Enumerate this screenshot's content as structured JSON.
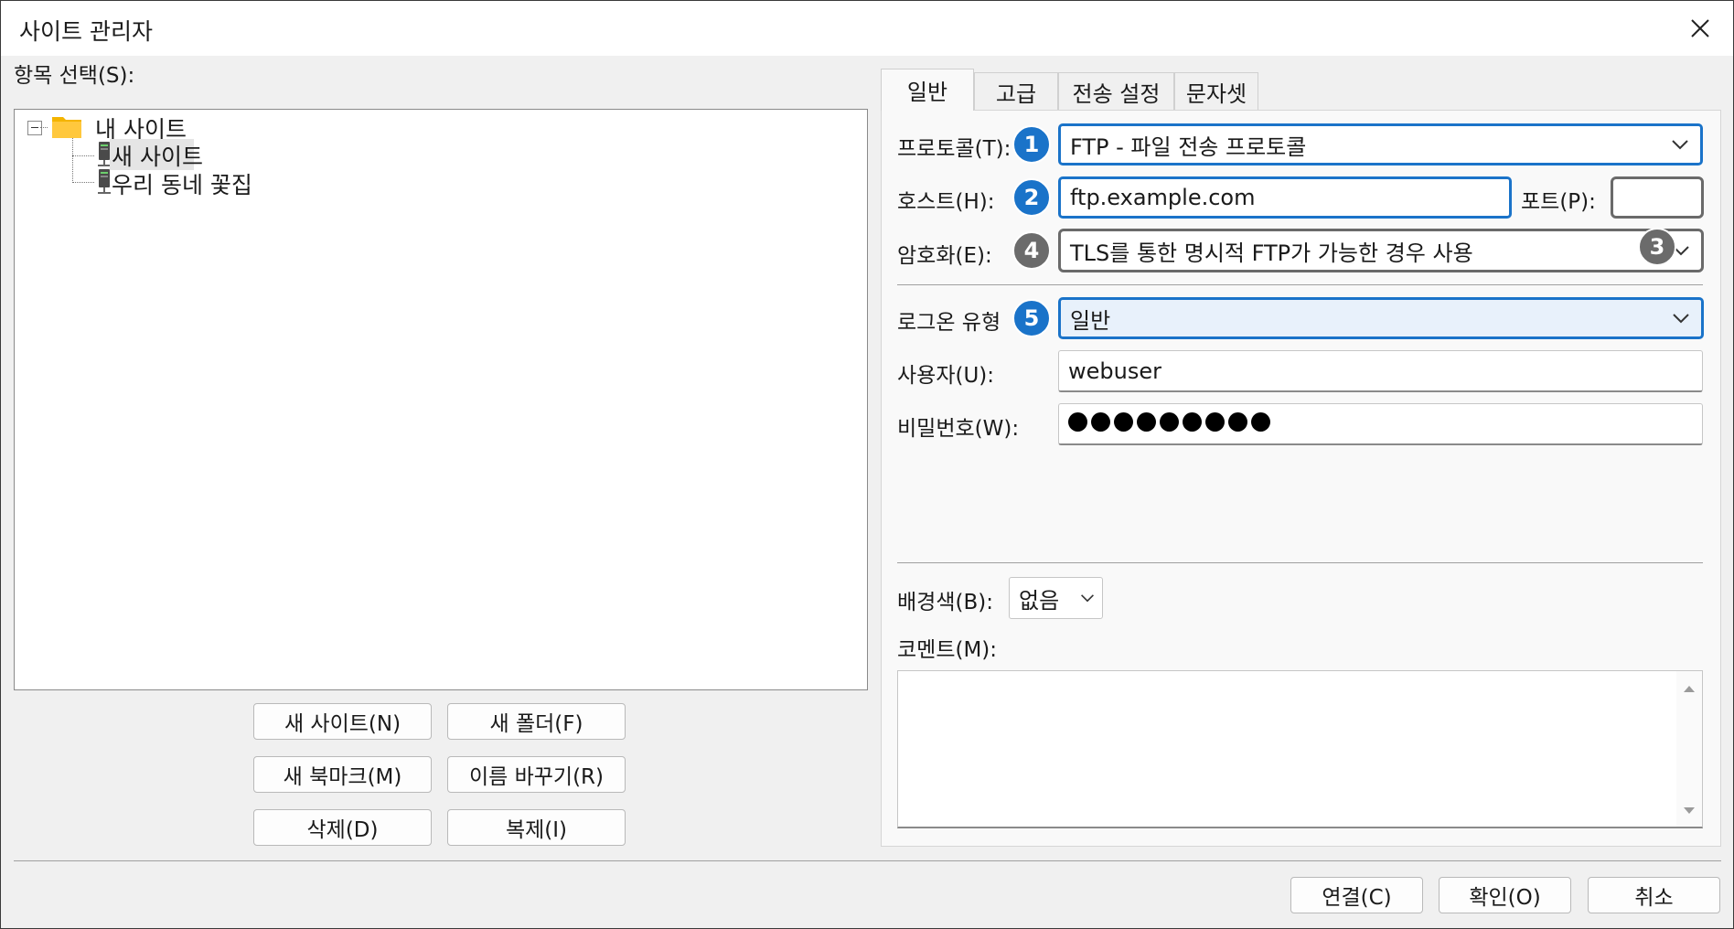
{
  "window": {
    "title": "사이트 관리자"
  },
  "left": {
    "select_label": "항목 선택(S):",
    "tree": {
      "root": "내 사이트",
      "children": [
        "새 사이트",
        "우리 동네 꽃집"
      ]
    },
    "buttons": {
      "new_site": "새 사이트(N)",
      "new_folder": "새 폴더(F)",
      "new_bookmark": "새 북마크(M)",
      "rename": "이름 바꾸기(R)",
      "delete": "삭제(D)",
      "duplicate": "복제(I)"
    }
  },
  "tabs": [
    "일반",
    "고급",
    "전송 설정",
    "문자셋"
  ],
  "general": {
    "protocol_label": "프로토콜(T):",
    "protocol_value": "FTP - 파일 전송 프로토콜",
    "host_label": "호스트(H):",
    "host_value": "ftp.example.com",
    "port_label": "포트(P):",
    "port_value": "",
    "encryption_label": "암호화(E):",
    "encryption_value": "TLS를 통한 명시적 FTP가 가능한 경우 사용",
    "logon_label": "로그온 유형",
    "logon_value": "일반",
    "user_label": "사용자(U):",
    "user_value": "webuser",
    "password_label": "비밀번호(W):",
    "password_dots": 9,
    "bgcolor_label": "배경색(B):",
    "bgcolor_value": "없음",
    "comment_label": "코멘트(M):"
  },
  "badges": [
    "1",
    "2",
    "3",
    "4",
    "5"
  ],
  "footer": {
    "connect": "연결(C)",
    "ok": "확인(O)",
    "cancel": "취소"
  },
  "colors": {
    "accent_blue": "#1a73c9",
    "badge_grey": "#6b6b6b",
    "folder": "#f4b400"
  }
}
